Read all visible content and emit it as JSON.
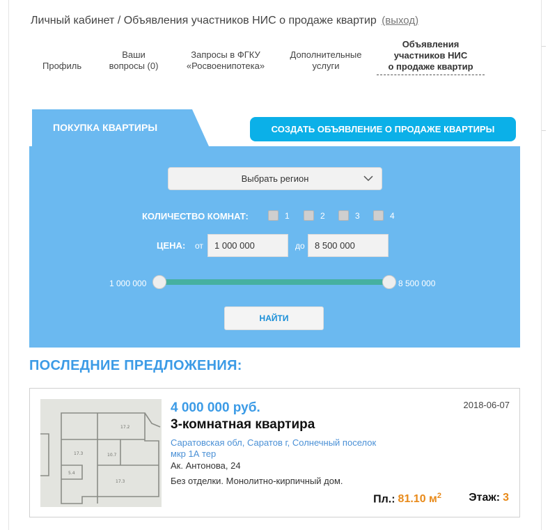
{
  "header": {
    "breadcrumb": "Личный кабинет / Объявления участников НИС о продаже квартир",
    "logout": "(выход)"
  },
  "tabs": [
    {
      "line1": "Профиль",
      "line2": "",
      "line3": ""
    },
    {
      "line1": "Ваши",
      "line2": "вопросы (0)",
      "line3": ""
    },
    {
      "line1": "Запросы в ФГКУ",
      "line2": "«Росвоенипотека»",
      "line3": ""
    },
    {
      "line1": "Дополнительные",
      "line2": "услуги",
      "line3": ""
    },
    {
      "line1": "Объявления",
      "line2": "участников НИС",
      "line3": "о продаже квартир"
    }
  ],
  "active_tab": 4,
  "buy_tab_label": "ПОКУПКА КВАРТИРЫ",
  "create_button_label": "СОЗДАТЬ ОБЪЯВЛЕНИЕ О ПРОДАЖЕ КВАРТИРЫ",
  "search": {
    "region_value": "Выбрать регион",
    "rooms_label": "КОЛИЧЕСТВО КОМНАТ:",
    "rooms": [
      "1",
      "2",
      "3",
      "4"
    ],
    "price_label": "ЦЕНА:",
    "from_label": "от",
    "to_label": "до",
    "price_from": "1 000 000",
    "price_to": "8 500 000",
    "range_min_label": "1 000 000",
    "range_max_label": "8 500 000",
    "find_label": "НАЙТИ"
  },
  "latest_title": "ПОСЛЕДНИЕ ПРЕДЛОЖЕНИЯ:",
  "offer": {
    "price": "4 000 000 руб.",
    "date": "2018-06-07",
    "title": "3-комнатная квартира",
    "address_line1": "Саратовская обл, Саратов г, Солнечный поселок",
    "address_line2": "мкр 1А тер",
    "street": "Ак. Антонова, 24",
    "description": "Без отделки. Монолитно-кирпичный дом.",
    "area_label": "Пл.:",
    "area_value": "81.10 м",
    "area_unit_sup": "2",
    "floor_label": "Этаж:",
    "floor_value": "3"
  },
  "colors": {
    "panel": "#6bb9f0",
    "create_button": "#0bb0e8",
    "slider": "#46b0a0",
    "link_blue": "#3c9be6",
    "accent_orange": "#e88a1a"
  },
  "icons": [
    "chevron-down-icon",
    "checkbox-icon",
    "floor-plan-image"
  ]
}
